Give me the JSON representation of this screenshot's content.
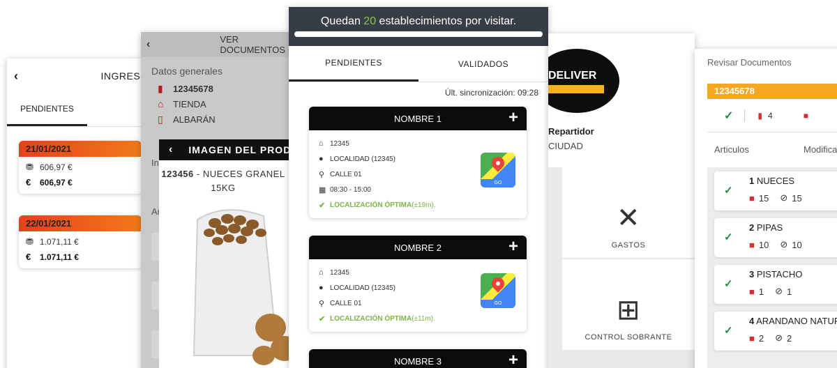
{
  "ingresos": {
    "title": "INGRESOS",
    "tab_pending": "PENDIENTES",
    "cards": [
      {
        "date": "21/01/2021",
        "amount": "606,97 €",
        "total": "606,97 €"
      },
      {
        "date": "22/01/2021",
        "amount": "1.071,11 €",
        "total": "1.071,11 €"
      }
    ]
  },
  "documentos": {
    "title": "VER DOCUMENTOS",
    "section_general": "Datos generales",
    "doc_number": "12345678",
    "type": "TIENDA",
    "doc_kind": "ALBARÁN",
    "partial_label_1": "In",
    "partial_label_2": "Ar"
  },
  "imagen": {
    "title": "IMAGEN DEL PRODUCTO",
    "code": "123456",
    "name": " - NUECES GRANEL",
    "weight": "15KG"
  },
  "establecimientos": {
    "banner_prefix": "Quedan ",
    "banner_count": "20",
    "banner_suffix": " establecimientos por visitar.",
    "tab_pending": "PENDIENTES",
    "tab_validated": "VALIDADOS",
    "sync": "Últ. sincronización: 09:28",
    "cards": [
      {
        "name": "NOMBRE 1",
        "code": "12345",
        "locality": "LOCALIDAD (12345)",
        "street": "CALLE 01",
        "hours": "08:30 - 15:00",
        "status": "LOCALIZACIÓN ÓPTIMA",
        "accuracy": " (±19m).",
        "maps_label": "GO"
      },
      {
        "name": "NOMBRE 2",
        "code": "12345",
        "locality": "LOCALIDAD (12345)",
        "street": "CALLE 01",
        "status": "LOCALIZACIÓN ÓPTIMA",
        "accuracy": " (±11m).",
        "maps_label": "GO"
      },
      {
        "name": "NOMBRE 3"
      }
    ]
  },
  "menu": {
    "logo_text": "DELIVER",
    "user": "Repartidor",
    "city": "CIUDAD",
    "tiles": [
      {
        "label": "GASTOS",
        "icon": "fork-knife-icon"
      },
      {
        "label": "CONTROL SOBRANTE",
        "icon": "boxes-add-icon"
      }
    ]
  },
  "revisar": {
    "title": "Revisar Documentos",
    "doc_number": "12345678",
    "doc_count": "4",
    "col_articles": "Articulos",
    "col_modified": "Modificado",
    "items": [
      {
        "num": "1",
        "name": "NUECES",
        "qty": "15",
        "checked": "15"
      },
      {
        "num": "2",
        "name": "PIPAS",
        "qty": "10",
        "checked": "10"
      },
      {
        "num": "3",
        "name": "PISTACHO",
        "qty": "1",
        "checked": "1"
      },
      {
        "num": "4",
        "name": "ARANDANO NATURAL",
        "qty": "2",
        "checked": "2"
      }
    ]
  },
  "colors": {
    "accent_green": "#8bc34a",
    "header_dark": "#363d45",
    "date_orange": "#e8401c",
    "badge_orange": "#f5a623"
  }
}
